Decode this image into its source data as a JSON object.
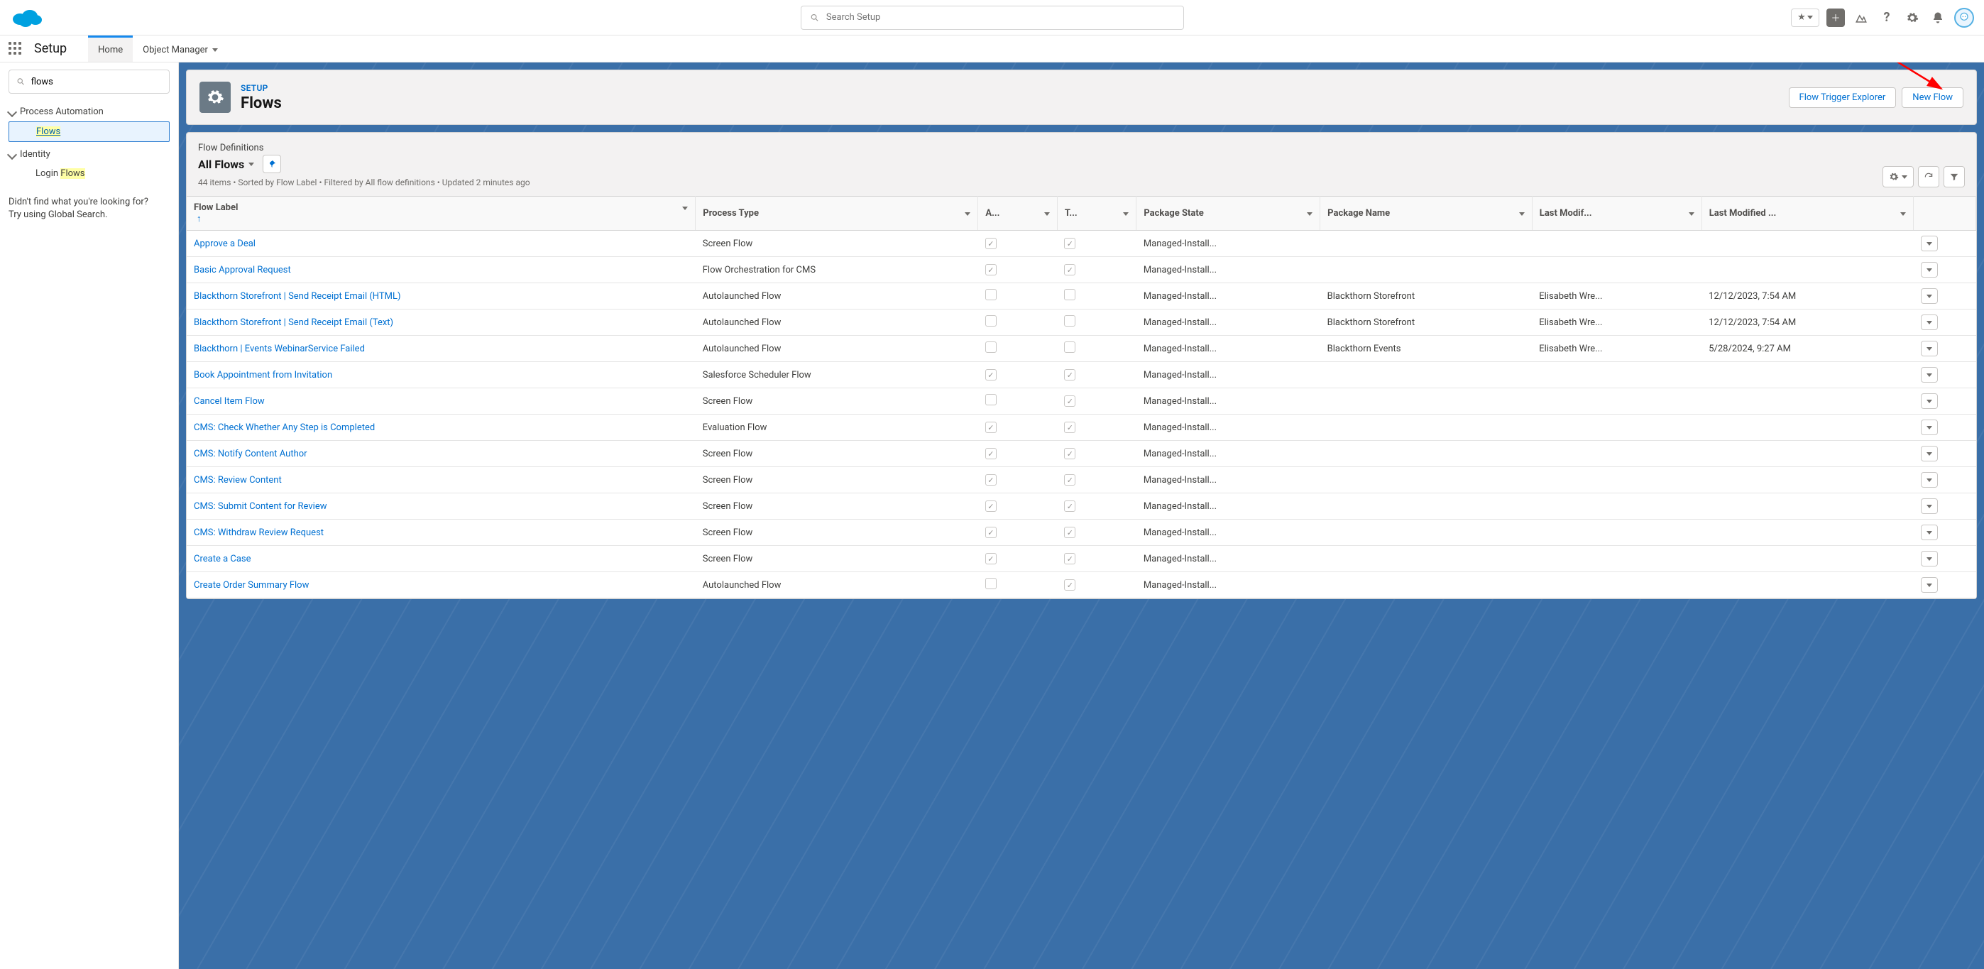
{
  "global": {
    "search_placeholder": "Search Setup"
  },
  "context": {
    "app_name": "Setup",
    "tabs": [
      {
        "label": "Home",
        "active": true
      },
      {
        "label": "Object Manager",
        "active": false,
        "has_caret": true
      }
    ]
  },
  "sidebar": {
    "quick_find_value": "flows",
    "sections": [
      {
        "label": "Process Automation",
        "items": [
          {
            "label": "Flows",
            "selected": true,
            "highlight": "Flows"
          }
        ]
      },
      {
        "label": "Identity",
        "items": [
          {
            "label": "Login Flows",
            "selected": false,
            "highlight": "Flows"
          }
        ]
      }
    ],
    "help_text_1": "Didn't find what you're looking for?",
    "help_text_2": "Try using Global Search."
  },
  "page_header": {
    "crumb": "SETUP",
    "title": "Flows",
    "actions": [
      {
        "label": "Flow Trigger Explorer"
      },
      {
        "label": "New Flow"
      }
    ]
  },
  "list": {
    "object_label": "Flow Definitions",
    "view_name": "All Flows",
    "meta": "44 items • Sorted by Flow Label • Filtered by All flow definitions • Updated 2 minutes ago",
    "columns": [
      {
        "key": "label",
        "label": "Flow Label",
        "sorted": true
      },
      {
        "key": "ptype",
        "label": "Process Type"
      },
      {
        "key": "a",
        "label": "A..."
      },
      {
        "key": "t",
        "label": "T..."
      },
      {
        "key": "pstate",
        "label": "Package State"
      },
      {
        "key": "pname",
        "label": "Package Name"
      },
      {
        "key": "lmb",
        "label": "Last Modif..."
      },
      {
        "key": "lmd",
        "label": "Last Modified ..."
      }
    ],
    "rows": [
      {
        "label": "Approve a Deal",
        "ptype": "Screen Flow",
        "a": true,
        "t": true,
        "pstate": "Managed-Install...",
        "pname": "",
        "lmb": "",
        "lmd": ""
      },
      {
        "label": "Basic Approval Request",
        "ptype": "Flow Orchestration for CMS",
        "a": true,
        "t": true,
        "pstate": "Managed-Install...",
        "pname": "",
        "lmb": "",
        "lmd": ""
      },
      {
        "label": "Blackthorn Storefront | Send Receipt Email (HTML)",
        "ptype": "Autolaunched Flow",
        "a": false,
        "t": false,
        "pstate": "Managed-Install...",
        "pname": "Blackthorn Storefront",
        "lmb": "Elisabeth Wre...",
        "lmd": "12/12/2023, 7:54 AM"
      },
      {
        "label": "Blackthorn Storefront | Send Receipt Email (Text)",
        "ptype": "Autolaunched Flow",
        "a": false,
        "t": false,
        "pstate": "Managed-Install...",
        "pname": "Blackthorn Storefront",
        "lmb": "Elisabeth Wre...",
        "lmd": "12/12/2023, 7:54 AM"
      },
      {
        "label": "Blackthorn | Events WebinarService Failed",
        "ptype": "Autolaunched Flow",
        "a": false,
        "t": false,
        "pstate": "Managed-Install...",
        "pname": "Blackthorn Events",
        "lmb": "Elisabeth Wre...",
        "lmd": "5/28/2024, 9:27 AM"
      },
      {
        "label": "Book Appointment from Invitation",
        "ptype": "Salesforce Scheduler Flow",
        "a": true,
        "t": true,
        "pstate": "Managed-Install...",
        "pname": "",
        "lmb": "",
        "lmd": ""
      },
      {
        "label": "Cancel Item Flow",
        "ptype": "Screen Flow",
        "a": false,
        "t": true,
        "pstate": "Managed-Install...",
        "pname": "",
        "lmb": "",
        "lmd": ""
      },
      {
        "label": "CMS: Check Whether Any Step is Completed",
        "ptype": "Evaluation Flow",
        "a": true,
        "t": true,
        "pstate": "Managed-Install...",
        "pname": "",
        "lmb": "",
        "lmd": ""
      },
      {
        "label": "CMS: Notify Content Author",
        "ptype": "Screen Flow",
        "a": true,
        "t": true,
        "pstate": "Managed-Install...",
        "pname": "",
        "lmb": "",
        "lmd": ""
      },
      {
        "label": "CMS: Review Content",
        "ptype": "Screen Flow",
        "a": true,
        "t": true,
        "pstate": "Managed-Install...",
        "pname": "",
        "lmb": "",
        "lmd": ""
      },
      {
        "label": "CMS: Submit Content for Review",
        "ptype": "Screen Flow",
        "a": true,
        "t": true,
        "pstate": "Managed-Install...",
        "pname": "",
        "lmb": "",
        "lmd": ""
      },
      {
        "label": "CMS: Withdraw Review Request",
        "ptype": "Screen Flow",
        "a": true,
        "t": true,
        "pstate": "Managed-Install...",
        "pname": "",
        "lmb": "",
        "lmd": ""
      },
      {
        "label": "Create a Case",
        "ptype": "Screen Flow",
        "a": true,
        "t": true,
        "pstate": "Managed-Install...",
        "pname": "",
        "lmb": "",
        "lmd": ""
      },
      {
        "label": "Create Order Summary Flow",
        "ptype": "Autolaunched Flow",
        "a": false,
        "t": true,
        "pstate": "Managed-Install...",
        "pname": "",
        "lmb": "",
        "lmd": ""
      }
    ]
  }
}
